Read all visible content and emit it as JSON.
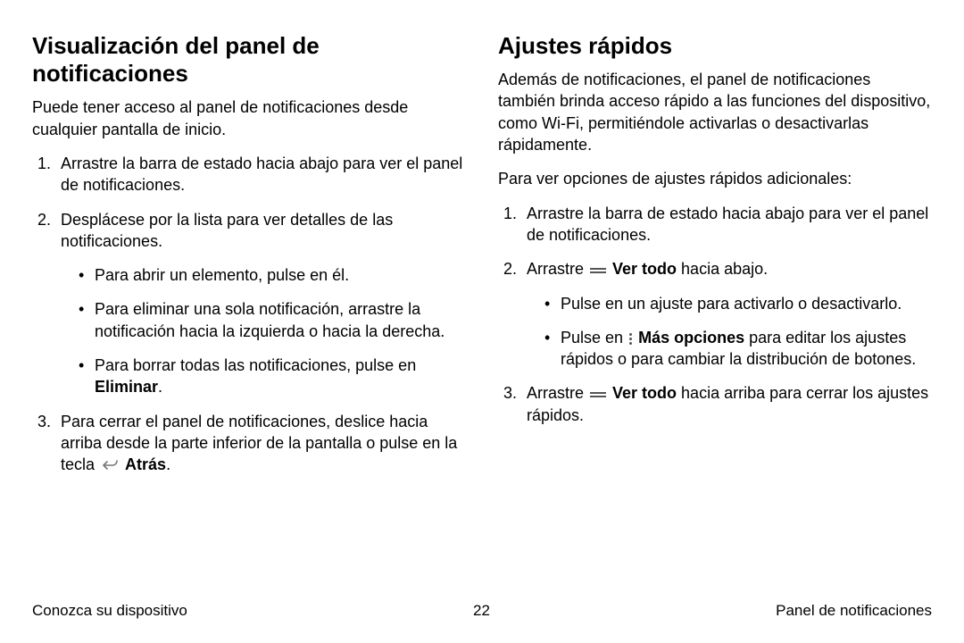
{
  "left": {
    "heading": "Visualización del panel de notificaciones",
    "intro": "Puede tener acceso al panel de notificaciones desde cualquier pantalla de inicio.",
    "step1": "Arrastre la barra de estado hacia abajo para ver el panel de notificaciones.",
    "step2": "Desplácese por la lista para ver detalles de las notificaciones.",
    "step2_b1": "Para abrir un elemento, pulse en él.",
    "step2_b2": "Para eliminar una sola notificación, arrastre la notificación hacia la izquierda o hacia la derecha.",
    "step2_b3_pre": "Para borrar todas las notificaciones, pulse en ",
    "step2_b3_bold": "Eliminar",
    "step2_b3_post": ".",
    "step3_pre": "Para cerrar el panel de notificaciones, deslice hacia arriba desde la parte inferior de la pantalla o pulse en la tecla ",
    "step3_bold": "Atrás",
    "step3_post": "."
  },
  "right": {
    "heading": "Ajustes rápidos",
    "intro": "Además de notificaciones, el panel de notificaciones también brinda acceso rápido a las funciones del dispositivo, como Wi-Fi, permitiéndole activarlas o desactivarlas rápidamente.",
    "lead": "Para ver opciones de ajustes rápidos adicionales:",
    "step1": "Arrastre la barra de estado hacia abajo para ver el panel de notificaciones.",
    "step2_pre": "Arrastre ",
    "step2_bold": "Ver todo",
    "step2_post": " hacia abajo.",
    "step2_b1": "Pulse en un ajuste para activarlo o desactivarlo.",
    "step2_b2_pre": "Pulse en ",
    "step2_b2_bold": "Más opciones",
    "step2_b2_post": " para editar los ajustes rápidos o para cambiar la distribución de botones.",
    "step3_pre": "Arrastre ",
    "step3_bold": "Ver todo",
    "step3_post": " hacia arriba para cerrar los ajustes rápidos."
  },
  "footer": {
    "left": "Conozca su dispositivo",
    "center": "22",
    "right": "Panel de notificaciones"
  }
}
